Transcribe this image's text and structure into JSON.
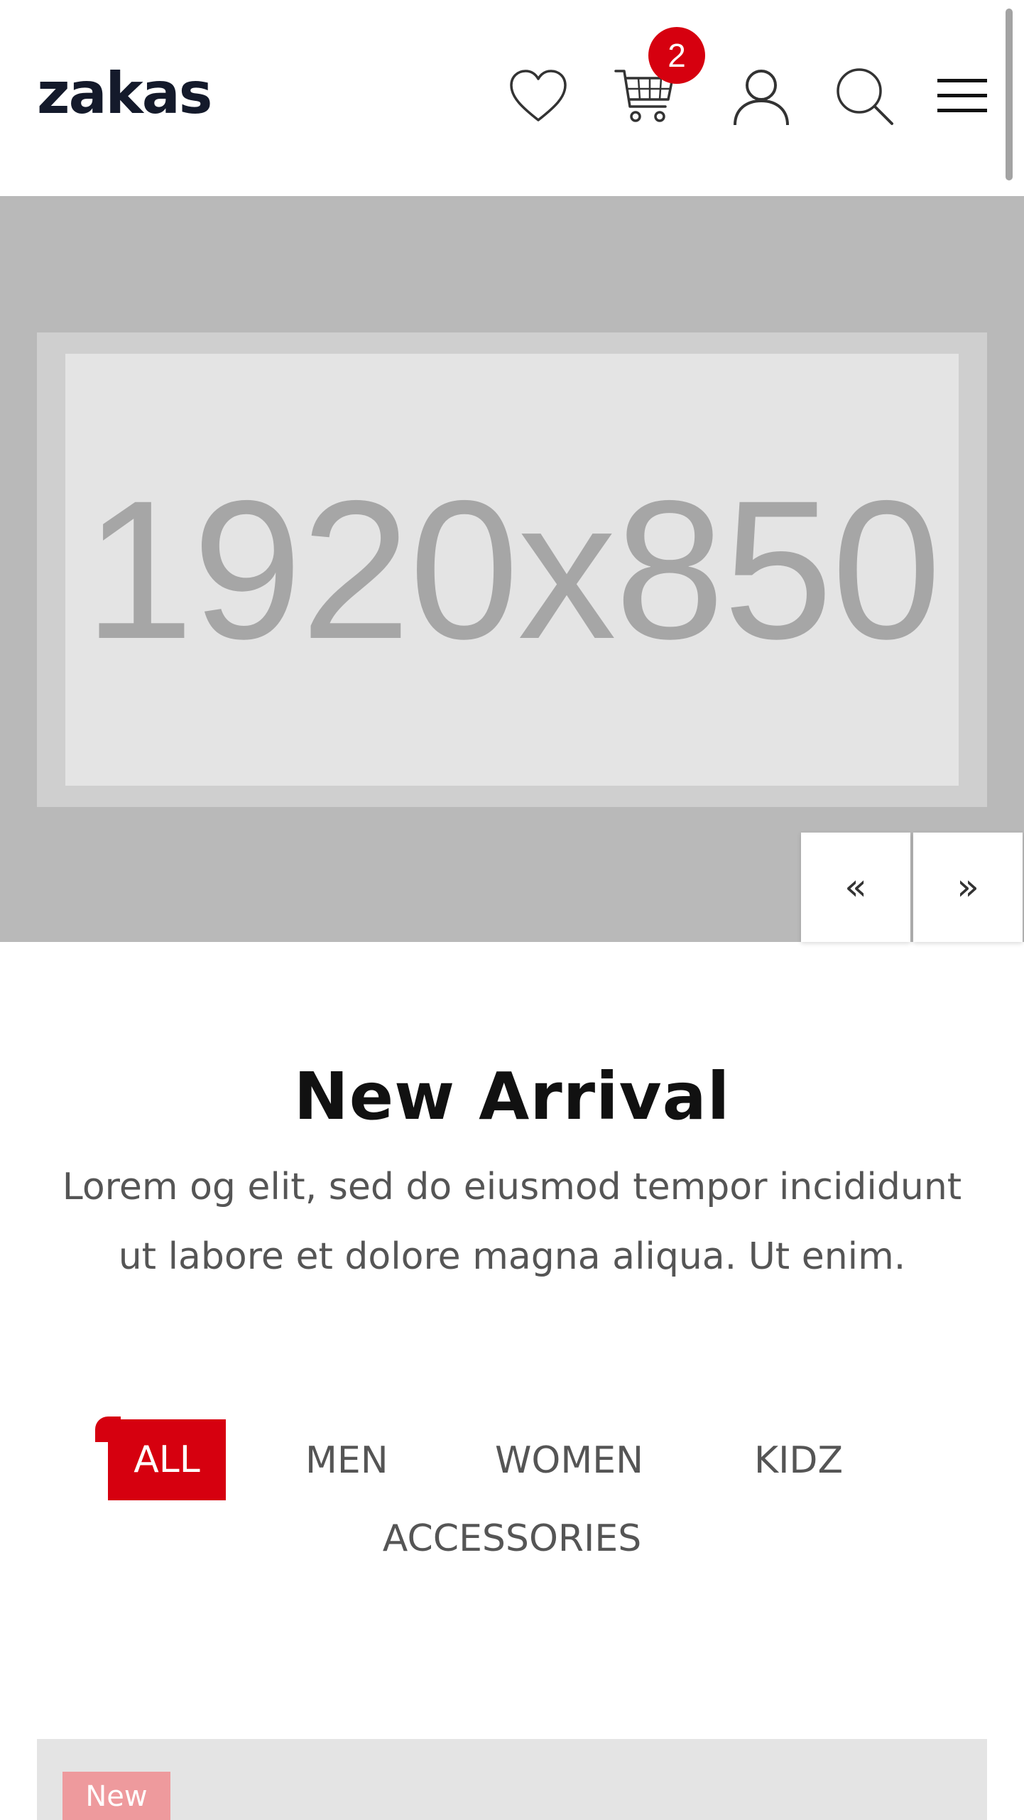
{
  "header": {
    "logo": "zakas",
    "icons": [
      "heart-icon",
      "cart-icon",
      "user-icon",
      "search-icon",
      "menu-icon"
    ],
    "cart_count": "2"
  },
  "hero": {
    "placeholder_text": "1920x850",
    "prev_label": "«",
    "next_label": "»"
  },
  "new_arrival": {
    "title": "New Arrival",
    "description": "Lorem og elit, sed do eiusmod tempor incididunt ut labore et dolore magna aliqua. Ut enim.",
    "tabs": [
      {
        "label": "ALL",
        "active": true
      },
      {
        "label": "MEN",
        "active": false
      },
      {
        "label": "WOMEN",
        "active": false
      },
      {
        "label": "KIDZ",
        "active": false
      },
      {
        "label": "ACCESSORIES",
        "active": false
      }
    ]
  },
  "product": {
    "badge": "New"
  },
  "colors": {
    "accent": "#d6000f",
    "hero_bg": "#b9b9b9",
    "placeholder_bg": "#e4e4e4",
    "badge_bg": "#ee9a9d"
  }
}
